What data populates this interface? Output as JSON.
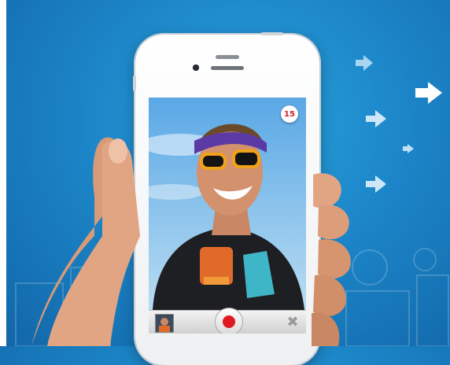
{
  "recording": {
    "count_badge": "15"
  },
  "icons": {
    "record": "record-icon",
    "close": "close-icon",
    "arrow": "arrow-right-icon"
  },
  "colors": {
    "background": "#1c86c8",
    "record": "#e01921",
    "badge_text": "#d0202a"
  }
}
